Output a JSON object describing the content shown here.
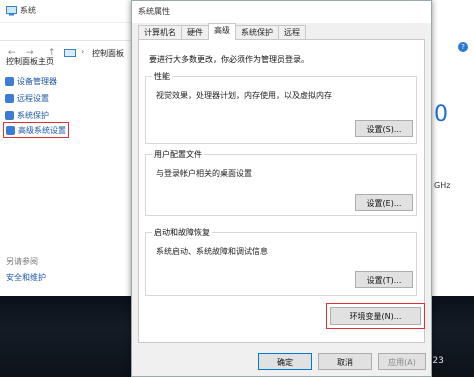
{
  "background_window": {
    "title": "系统",
    "breadcrumb": "控制面板",
    "nav_back": "←",
    "nav_forward": "→",
    "nav_up": "↑",
    "sidebar": {
      "home": "控制面板主页",
      "items": [
        {
          "label": "设备管理器",
          "icon": "shield-icon"
        },
        {
          "label": "远程设置",
          "icon": "shield-icon"
        },
        {
          "label": "系统保护",
          "icon": "shield-icon"
        },
        {
          "label": "高级系统设置",
          "icon": "shield-icon",
          "selected": true
        }
      ],
      "see_also": "另请参阅",
      "security": "安全和维护"
    },
    "right_digit": "0",
    "right_text": "GHz",
    "help_icon": "?"
  },
  "dialog": {
    "title": "系统属性",
    "tabs": [
      "计算机名",
      "硬件",
      "高级",
      "系统保护",
      "远程"
    ],
    "active_tab": "高级",
    "admin_note": "要进行大多数更改，你必须作为管理员登录。",
    "groups": [
      {
        "title": "性能",
        "desc": "视觉效果，处理器计划，内存使用，以及虚拟内存",
        "button": "设置(S)..."
      },
      {
        "title": "用户配置文件",
        "desc": "与登录帐户相关的桌面设置",
        "button": "设置(E)..."
      },
      {
        "title": "启动和故障恢复",
        "desc": "系统启动、系统故障和调试信息",
        "button": "设置(T)..."
      }
    ],
    "env_button": "环境变量(N)...",
    "footer": {
      "ok": "确定",
      "cancel": "取消",
      "apply": "应用(A)"
    }
  },
  "watermark": "CSDN @lgdf123",
  "colors": {
    "link": "#1a56a8",
    "highlight_outline": "#e03030",
    "accent_blue": "#2b79d6"
  }
}
